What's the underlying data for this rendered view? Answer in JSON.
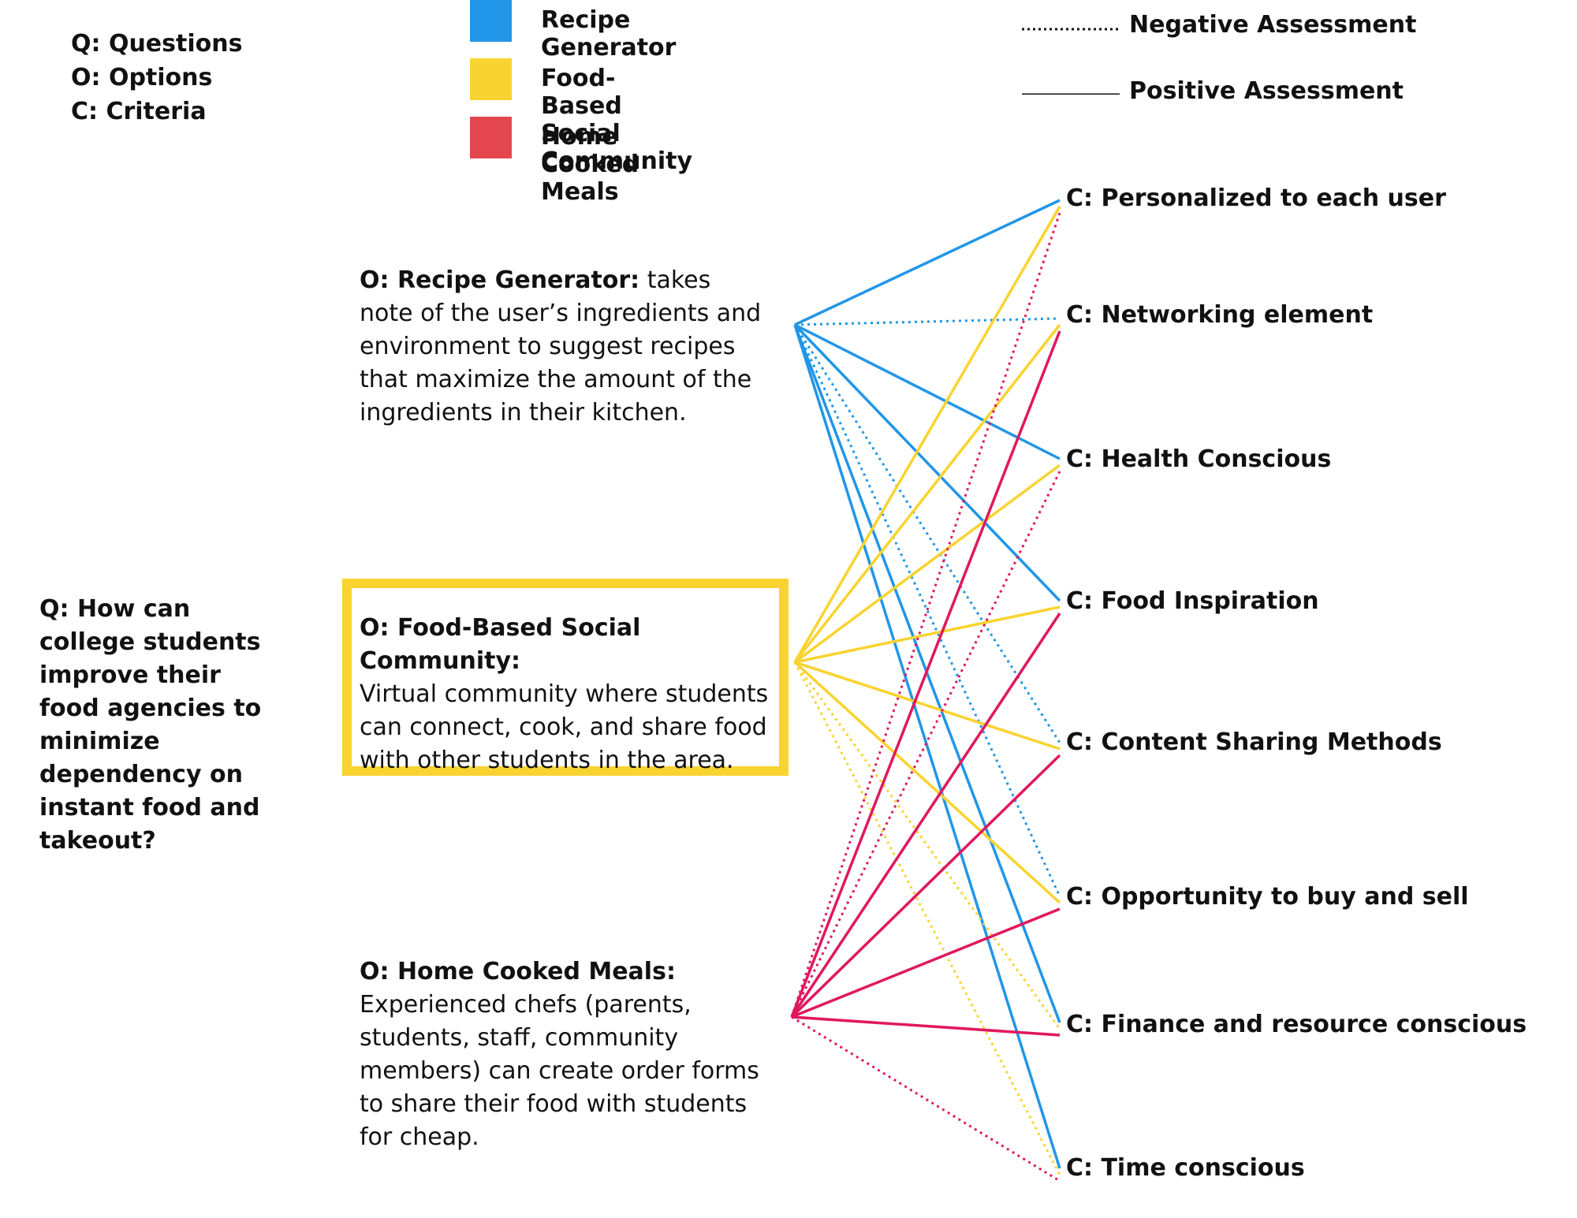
{
  "key": {
    "questions": "Q: Questions",
    "options": "O: Options",
    "criteria": "C: Criteria"
  },
  "legend": [
    {
      "label": "Recipe Generator",
      "color": "#2196E8"
    },
    {
      "label": "Food-Based Social Community",
      "color": "#F9D330"
    },
    {
      "label": "Home Cooked Meals",
      "color": "#E5474E"
    }
  ],
  "assessment_legend": {
    "negative": "Negative Assessment",
    "positive": "Positive Assessment"
  },
  "question": "Q: How can college students improve their food agencies to minimize dependency on instant food and takeout?",
  "options": [
    {
      "title": "O: Recipe Generator:",
      "text": " takes note of the user’s ingredients and environment to suggest recipes that maximize the amount of the ingredients in their kitchen."
    },
    {
      "title": "O: Food-Based Social Community:",
      "text": "Virtual community where students can connect, cook, and share food with other students in the area."
    },
    {
      "title": "O: Home Cooked Meals:",
      "text": "Experienced chefs (parents, students, staff, community members) can create order forms to share their food with students for cheap."
    }
  ],
  "criteria": [
    "C: Personalized to each user",
    "C: Networking element",
    "C: Health Conscious",
    "C: Food Inspiration",
    "C: Content Sharing Methods",
    "C: Opportunity to buy and sell",
    "C: Finance and resource conscious",
    "C: Time conscious"
  ],
  "link_colors": {
    "recipe": "#2196E8",
    "community": "#F9D330",
    "home": "#E0185E"
  },
  "links": [
    {
      "option": 0,
      "criterion": 0,
      "assessment": "positive"
    },
    {
      "option": 0,
      "criterion": 1,
      "assessment": "negative"
    },
    {
      "option": 0,
      "criterion": 2,
      "assessment": "positive"
    },
    {
      "option": 0,
      "criterion": 3,
      "assessment": "positive"
    },
    {
      "option": 0,
      "criterion": 4,
      "assessment": "negative"
    },
    {
      "option": 0,
      "criterion": 5,
      "assessment": "negative"
    },
    {
      "option": 0,
      "criterion": 6,
      "assessment": "positive"
    },
    {
      "option": 0,
      "criterion": 7,
      "assessment": "positive"
    },
    {
      "option": 1,
      "criterion": 0,
      "assessment": "positive"
    },
    {
      "option": 1,
      "criterion": 1,
      "assessment": "positive"
    },
    {
      "option": 1,
      "criterion": 2,
      "assessment": "positive"
    },
    {
      "option": 1,
      "criterion": 3,
      "assessment": "positive"
    },
    {
      "option": 1,
      "criterion": 4,
      "assessment": "positive"
    },
    {
      "option": 1,
      "criterion": 5,
      "assessment": "positive"
    },
    {
      "option": 1,
      "criterion": 6,
      "assessment": "negative"
    },
    {
      "option": 1,
      "criterion": 7,
      "assessment": "negative"
    },
    {
      "option": 2,
      "criterion": 0,
      "assessment": "negative"
    },
    {
      "option": 2,
      "criterion": 1,
      "assessment": "positive"
    },
    {
      "option": 2,
      "criterion": 2,
      "assessment": "negative"
    },
    {
      "option": 2,
      "criterion": 3,
      "assessment": "positive"
    },
    {
      "option": 2,
      "criterion": 4,
      "assessment": "positive"
    },
    {
      "option": 2,
      "criterion": 5,
      "assessment": "positive"
    },
    {
      "option": 2,
      "criterion": 6,
      "assessment": "positive"
    },
    {
      "option": 2,
      "criterion": 7,
      "assessment": "negative"
    }
  ]
}
